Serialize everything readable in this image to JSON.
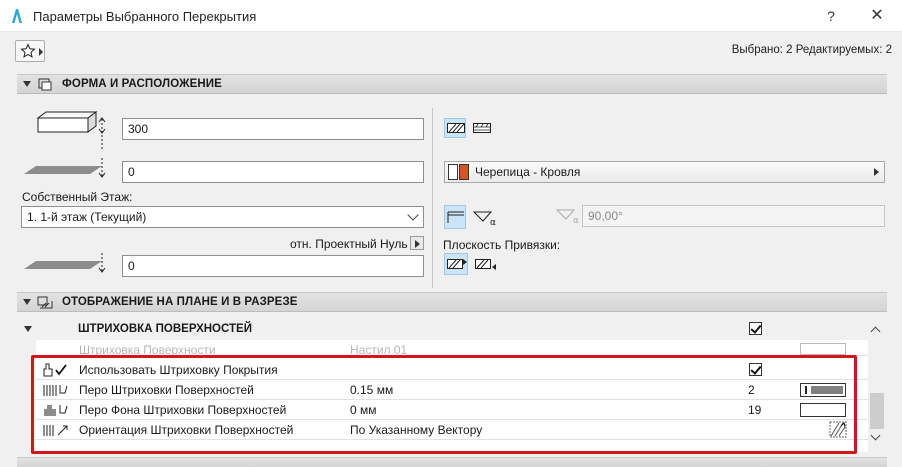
{
  "window": {
    "title": "Параметры Выбранного Перекрытия",
    "help": "?",
    "close": "✕",
    "selected_info": "Выбрано: 2 Редактируемых: 2"
  },
  "section_geometry": {
    "title": "ФОРМА И РАСПОЛОЖЕНИЕ",
    "thickness_value": "300",
    "offset_value": "0",
    "story_label": "Собственный Этаж:",
    "story_value": "1. 1-й этаж (Текущий)",
    "ref_label": "отн. Проектный Нуль",
    "level_value": "0",
    "material_value": "Черепица - Кровля",
    "angle_value": "90,00°",
    "plane_label": "Плоскость Привязки:"
  },
  "section_plan": {
    "title": "ОТОБРАЖЕНИЕ НА ПЛАНЕ И В РАЗРЕЗЕ",
    "group_title": "ШТРИХОВКА ПОВЕРХНОСТЕЙ",
    "rows": [
      {
        "name": "Штриховка Поверхности",
        "value": "Настил 01",
        "num": "",
        "disabled": true
      },
      {
        "name": "Использовать Штриховку Покрытия",
        "value": "",
        "num": "",
        "checked": true
      },
      {
        "name": "Перо Штриховки Поверхностей",
        "value": "0.15 мм",
        "num": "2"
      },
      {
        "name": "Перо Фона Штриховки Поверхностей",
        "value": "0 мм",
        "num": "19"
      },
      {
        "name": "Ориентация Штриховки Поверхностей",
        "value": "По Указанному Вектору",
        "num": ""
      }
    ]
  },
  "colors": {
    "highlight": "#d2161c",
    "active_button": "#cce4f7",
    "material_swatch": "#d9531e"
  }
}
